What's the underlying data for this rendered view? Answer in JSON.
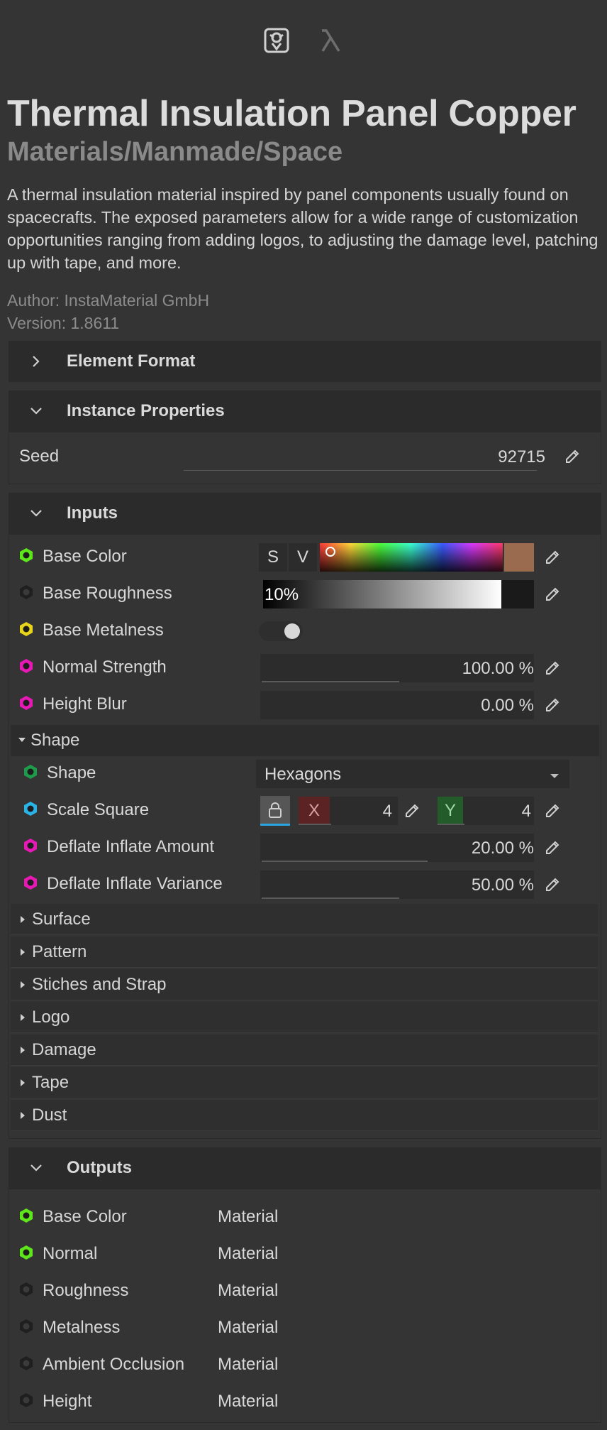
{
  "header": {
    "title": "Thermal Insulation Panel Copper",
    "subtitle": "Materials/Manmade/Space",
    "description": "A thermal insulation material inspired by panel components usually found on spacecrafts. The exposed parameters allow for a wide range of customization opportunities ranging from adding logos, to adjusting the damage level, patching up with tape, and more.",
    "author": "Author: InstaMaterial GmbH",
    "version": "Version: 1.8611"
  },
  "sections": {
    "element_format": "Element Format",
    "instance_properties": "Instance Properties",
    "inputs": "Inputs",
    "outputs": "Outputs"
  },
  "instance": {
    "seed_label": "Seed",
    "seed_value": "92715"
  },
  "inputs": {
    "base_color": {
      "label": "Base Color",
      "s": "S",
      "v": "V",
      "swatch": "#9b6b4f"
    },
    "base_roughness": {
      "label": "Base Roughness",
      "value": "10",
      "unit": "%"
    },
    "base_metalness": {
      "label": "Base Metalness"
    },
    "normal_strength": {
      "label": "Normal Strength",
      "value": "100.00 %",
      "fill": 0.5
    },
    "height_blur": {
      "label": "Height Blur",
      "value": "0.00 %"
    }
  },
  "shape_group": {
    "label": "Shape",
    "shape": {
      "label": "Shape",
      "value": "Hexagons"
    },
    "scale_square": {
      "label": "Scale Square",
      "x_label": "X",
      "x_value": "4",
      "y_label": "Y",
      "y_value": "4"
    },
    "deflate_amount": {
      "label": "Deflate Inflate Amount",
      "value": "20.00 %",
      "fill": 0.6
    },
    "deflate_variance": {
      "label": "Deflate Inflate Variance",
      "value": "50.00 %",
      "fill": 0.45
    }
  },
  "groups": [
    "Surface",
    "Pattern",
    "Stiches and Strap",
    "Logo",
    "Damage",
    "Tape",
    "Dust"
  ],
  "outputs": [
    {
      "label": "Base Color",
      "type": "Material",
      "color": "#5de619"
    },
    {
      "label": "Normal",
      "type": "Material",
      "color": "#5de619"
    },
    {
      "label": "Roughness",
      "type": "Material",
      "color": "#1f1f1f"
    },
    {
      "label": "Metalness",
      "type": "Material",
      "color": "#1f1f1f"
    },
    {
      "label": "Ambient Occlusion",
      "type": "Material",
      "color": "#1f1f1f"
    },
    {
      "label": "Height",
      "type": "Material",
      "color": "#1f1f1f"
    }
  ],
  "colors": {
    "green": "#5de619",
    "dark": "#1f1f1f",
    "yellow": "#e6d51a",
    "magenta": "#e619b5",
    "teal": "#1f9a4a",
    "cyan": "#29b3e6"
  }
}
